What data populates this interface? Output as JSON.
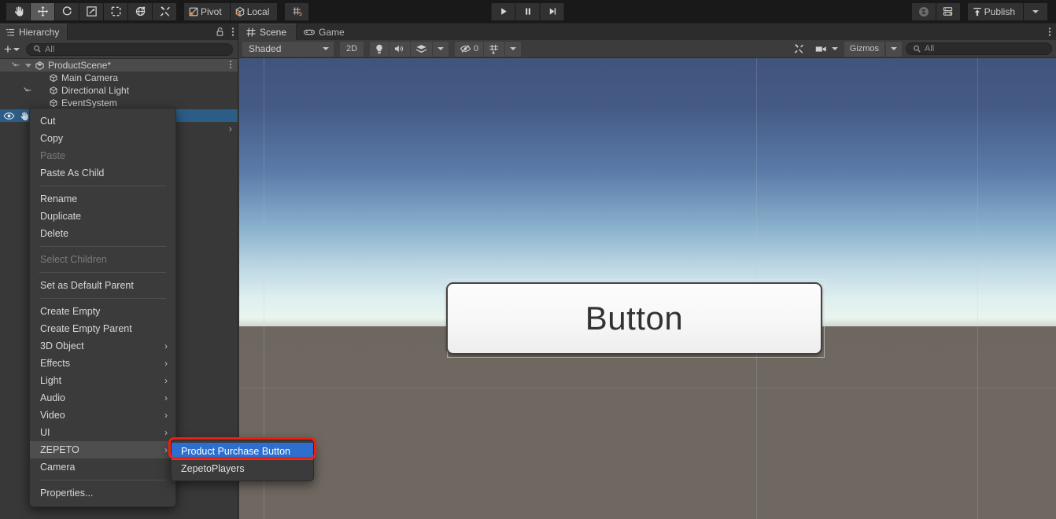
{
  "toolbar": {
    "tools": [
      {
        "name": "hand-tool",
        "icon": "hand",
        "selected": false
      },
      {
        "name": "move-tool",
        "icon": "move",
        "selected": true
      },
      {
        "name": "rotate-tool",
        "icon": "rotate",
        "selected": false
      },
      {
        "name": "scale-tool",
        "icon": "scale",
        "selected": false
      },
      {
        "name": "rect-tool",
        "icon": "rect",
        "selected": false
      },
      {
        "name": "transform-tool",
        "icon": "transform",
        "selected": false
      },
      {
        "name": "custom-tool",
        "icon": "wrench",
        "selected": false
      }
    ],
    "pivot_label": "Pivot",
    "local_label": "Local",
    "snap_icon": "grid-snap",
    "play_icon": "play",
    "pause_icon": "pause",
    "step_icon": "step",
    "cloud_icon": "zepeto-z",
    "layers_icon": "services",
    "publish_label": "Publish",
    "publish_dropdown_icon": "chevron-down-icon"
  },
  "hierarchy": {
    "tab_label": "Hierarchy",
    "tab_icon": "hierarchy-icon",
    "lock_icon": "lock-open-icon",
    "menu_icon": "kebab-icon",
    "add_label": "+",
    "search_placeholder": "All",
    "search_icon": "search-icon",
    "rows": [
      {
        "label": "ProductScene*",
        "icon": "scene-icon",
        "type": "scene",
        "depth": 0,
        "expanded": true,
        "kebab": true
      },
      {
        "label": "Main Camera",
        "icon": "gameobject-icon",
        "type": "object",
        "depth": 1
      },
      {
        "label": "Directional Light",
        "icon": "gameobject-icon",
        "type": "object",
        "depth": 1
      },
      {
        "label": "EventSystem",
        "icon": "gameobject-icon",
        "type": "object",
        "depth": 1
      },
      {
        "label": "",
        "icon": "gameobject-icon",
        "type": "object",
        "depth": 1,
        "selected": true
      }
    ]
  },
  "scene_panel": {
    "tabs": [
      {
        "label": "Scene",
        "icon": "scene-grid-icon",
        "active": true
      },
      {
        "label": "Game",
        "icon": "gamepad-icon",
        "active": false
      }
    ],
    "kebab_icon": "kebab-icon",
    "draw_mode": "Shaded",
    "draw_mode_arrow": "chevron-down-icon",
    "toggle_2d": "2D",
    "lighting_icon": "lightbulb-icon",
    "audio_icon": "speaker-icon",
    "fx_icon": "effects-icon",
    "fx_arrow": "chevron-down-icon",
    "hidden_count": "0",
    "hidden_icon": "eye-off-icon",
    "grid_icon": "grid-visibility-icon",
    "grid_arrow": "chevron-down-icon",
    "tools_icon": "wrench-icon",
    "camera_icon": "camera-icon",
    "camera_arrow": "chevron-down-icon",
    "gizmos_label": "Gizmos",
    "gizmos_arrow": "chevron-down-icon",
    "gizmo_search_placeholder": "All",
    "gizmo_search_icon": "search-icon"
  },
  "viewport": {
    "button_label": "Button"
  },
  "context_menu": {
    "items": [
      {
        "label": "Cut",
        "type": "item"
      },
      {
        "label": "Copy",
        "type": "item"
      },
      {
        "label": "Paste",
        "type": "item",
        "disabled": true
      },
      {
        "label": "Paste As Child",
        "type": "item"
      },
      {
        "type": "separator"
      },
      {
        "label": "Rename",
        "type": "item"
      },
      {
        "label": "Duplicate",
        "type": "item"
      },
      {
        "label": "Delete",
        "type": "item"
      },
      {
        "type": "separator"
      },
      {
        "label": "Select Children",
        "type": "item",
        "disabled": true
      },
      {
        "type": "separator"
      },
      {
        "label": "Set as Default Parent",
        "type": "item"
      },
      {
        "type": "separator"
      },
      {
        "label": "Create Empty",
        "type": "item"
      },
      {
        "label": "Create Empty Parent",
        "type": "item"
      },
      {
        "label": "3D Object",
        "type": "item",
        "submenu": true
      },
      {
        "label": "Effects",
        "type": "item",
        "submenu": true
      },
      {
        "label": "Light",
        "type": "item",
        "submenu": true
      },
      {
        "label": "Audio",
        "type": "item",
        "submenu": true
      },
      {
        "label": "Video",
        "type": "item",
        "submenu": true
      },
      {
        "label": "UI",
        "type": "item",
        "submenu": true
      },
      {
        "label": "ZEPETO",
        "type": "item",
        "submenu": true,
        "highlighted": true
      },
      {
        "label": "Camera",
        "type": "item"
      },
      {
        "type": "separator"
      },
      {
        "label": "Properties...",
        "type": "item"
      }
    ]
  },
  "submenu": {
    "items": [
      {
        "label": "Product Purchase Button",
        "active": true
      },
      {
        "label": "ZepetoPlayers",
        "active": false
      }
    ]
  },
  "colors": {
    "accent_blue": "#2c6fcf",
    "selection_blue": "#2c5d87",
    "highlight_red": "#f01e0e",
    "panel_bg": "#383838",
    "toolbar_bg": "#191919",
    "menu_bg": "#3b3b3b",
    "ground": "#6f6861",
    "sky_top": "#41547c"
  }
}
